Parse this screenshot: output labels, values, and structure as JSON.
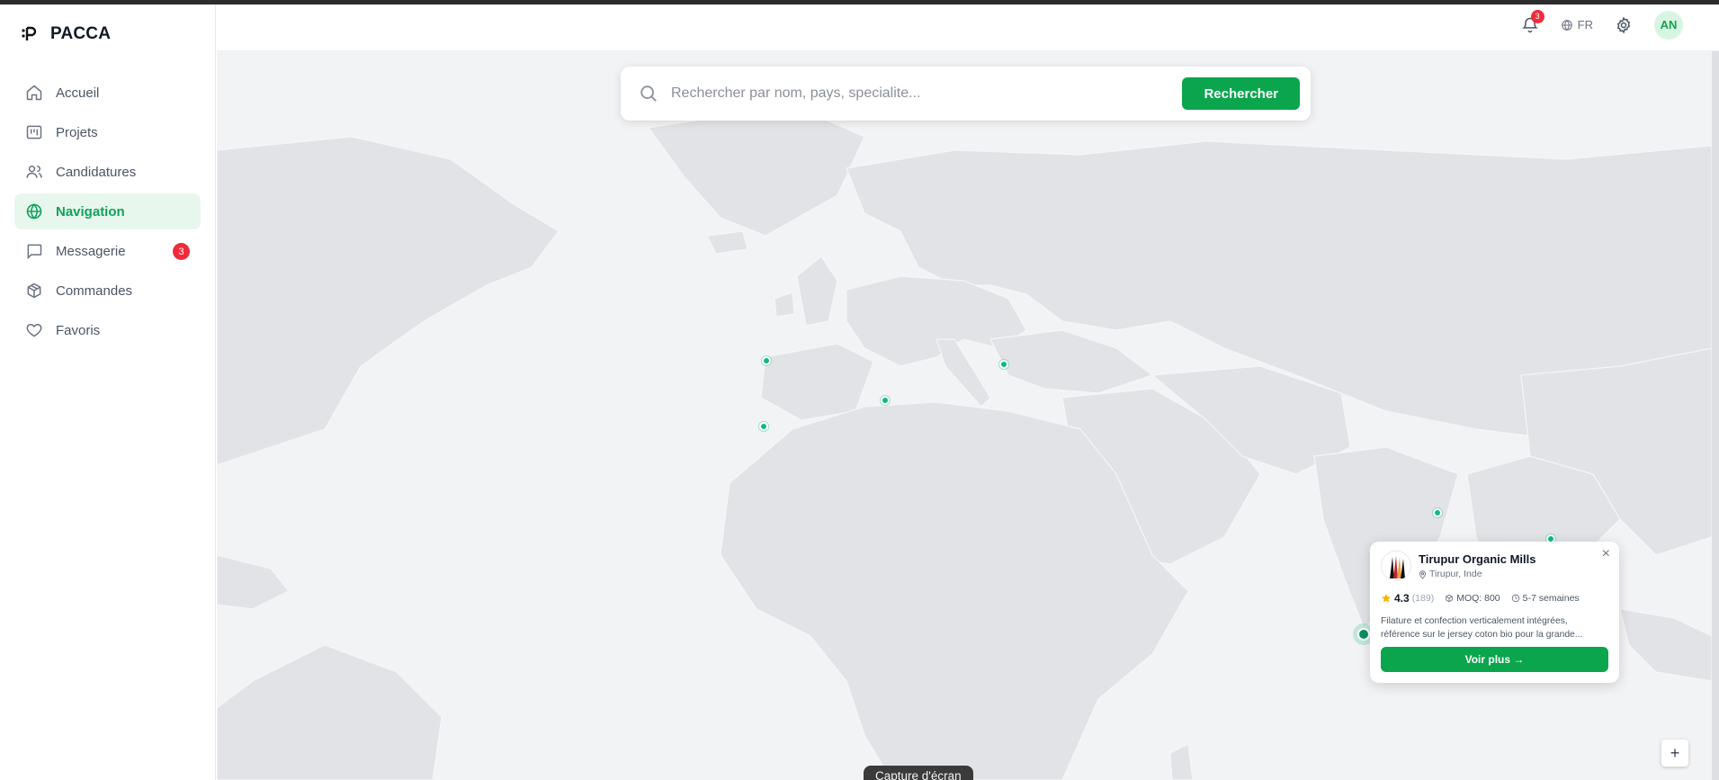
{
  "brand": {
    "name": "PACCA"
  },
  "sidebar": {
    "items": [
      {
        "label": "Accueil",
        "icon": "home-icon"
      },
      {
        "label": "Projets",
        "icon": "board-icon"
      },
      {
        "label": "Candidatures",
        "icon": "users-icon"
      },
      {
        "label": "Navigation",
        "icon": "globe-icon",
        "active": true
      },
      {
        "label": "Messagerie",
        "icon": "chat-icon",
        "badge": "3"
      },
      {
        "label": "Commandes",
        "icon": "box-icon"
      },
      {
        "label": "Favoris",
        "icon": "heart-icon"
      }
    ]
  },
  "header": {
    "notifications_count": "3",
    "language": "FR",
    "avatar_initials": "AN"
  },
  "search": {
    "placeholder": "Rechercher par nom, pays, specialite...",
    "button_label": "Rechercher"
  },
  "popup": {
    "title": "Tirupur Organic Mills",
    "location": "Tirupur, Inde",
    "rating": "4.3",
    "reviews": "(189)",
    "moq": "MOQ: 800",
    "lead_time": "5-7 semaines",
    "description": "Filature et confection verticalement intégrées, référence sur le jersey coton bio pour la grande...",
    "button_label": "Voir plus →",
    "close_label": "×"
  },
  "map": {
    "zoom_in_label": "+"
  },
  "toast": {
    "label": "Capture d'écran"
  },
  "colors": {
    "accent": "#0aa54c",
    "active_bg": "#e8f7ee",
    "badge": "#ef2b3d",
    "marker": "#10b981"
  }
}
